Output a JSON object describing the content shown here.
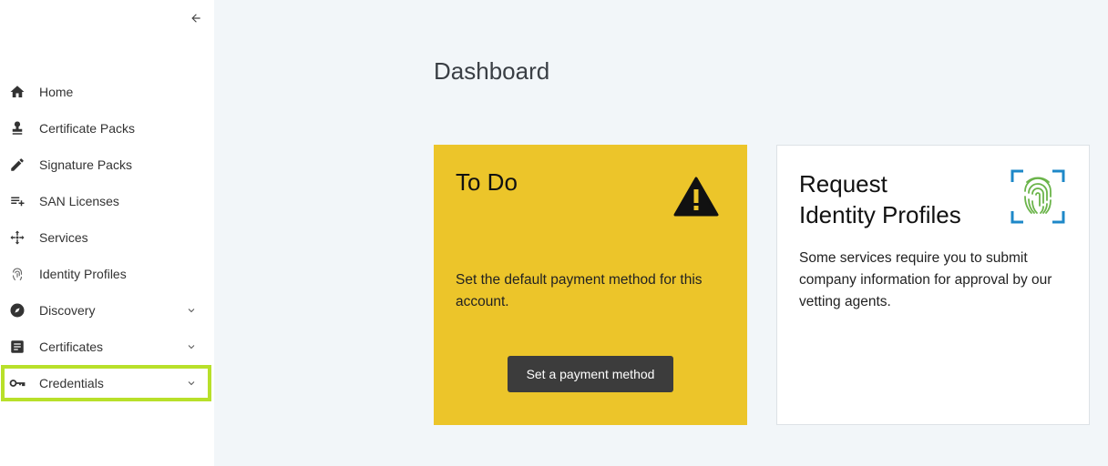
{
  "sidebar": {
    "items": [
      {
        "label": "Home"
      },
      {
        "label": "Certificate Packs"
      },
      {
        "label": "Signature Packs"
      },
      {
        "label": "SAN Licenses"
      },
      {
        "label": "Services"
      },
      {
        "label": "Identity Profiles"
      },
      {
        "label": "Discovery"
      },
      {
        "label": "Certificates"
      },
      {
        "label": "Credentials"
      }
    ],
    "icons": [
      "arrow-left-icon",
      "home-icon",
      "stamp-icon",
      "pen-icon",
      "playlist-add-icon",
      "move-icon",
      "fingerprint-icon",
      "compass-icon",
      "document-icon",
      "key-icon",
      "chevron-down-icon"
    ]
  },
  "main": {
    "title": "Dashboard",
    "todo_card": {
      "title": "To Do",
      "text": "Set the default payment method for this account.",
      "button_label": "Set a payment method",
      "background": "#ecc52a"
    },
    "identity_card": {
      "title_line1": "Request",
      "title_line2": "Identity Profiles",
      "text": "Some services require you to submit company information for approval by our vetting agents."
    }
  },
  "colors": {
    "highlight": "#b8e02a",
    "background": "#f2f6f9",
    "button": "#3c3c3c",
    "fingerprint_green": "#6bb44a",
    "fingerprint_frame": "#1e88c8"
  }
}
